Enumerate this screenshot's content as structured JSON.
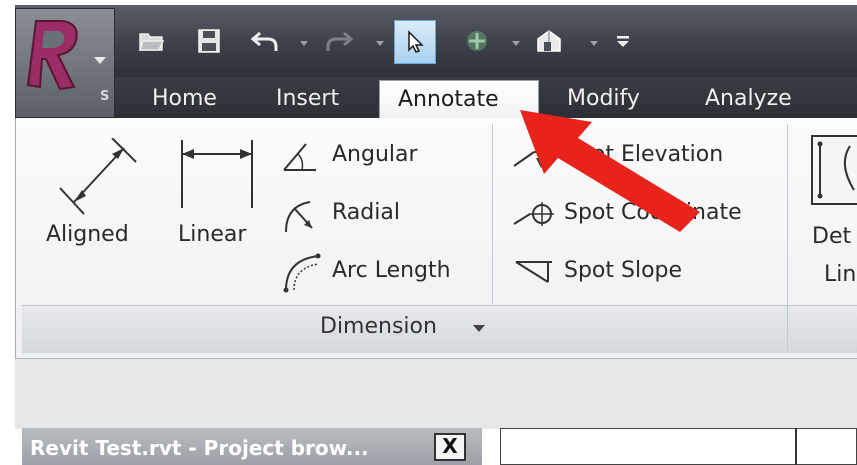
{
  "app": {
    "logo_letter": "R",
    "app_menu_shortcut": "S",
    "brand_color": "#8e2a5a"
  },
  "quick_access": {
    "items": [
      "open-folder-icon",
      "save-icon",
      "undo-icon",
      "redo-icon",
      "select-arrow-icon",
      "sync-icon",
      "3d-view-icon",
      "customize-dropdown-icon"
    ]
  },
  "tabs": [
    {
      "label": "Home"
    },
    {
      "label": "Insert"
    },
    {
      "label": "Annotate",
      "active": true
    },
    {
      "label": "Modify"
    },
    {
      "label": "Analyze"
    }
  ],
  "ribbon": {
    "dimension_panel": {
      "label": "Dimension",
      "tools": {
        "aligned": "Aligned",
        "linear": "Linear",
        "angular": "Angular",
        "radial": "Radial",
        "arc_length": "Arc Length",
        "spot_elevation": "Spot Elevation",
        "spot_coordinate": "Spot Coordinate",
        "spot_slope": "Spot Slope"
      }
    },
    "detail_panel": {
      "tool_line1": "Det",
      "tool_line2": "Lin"
    }
  },
  "project_browser": {
    "title": "Revit Test.rvt - Project brow...",
    "close_label": "X"
  },
  "annotation": {
    "arrow_color": "#e8231c"
  }
}
